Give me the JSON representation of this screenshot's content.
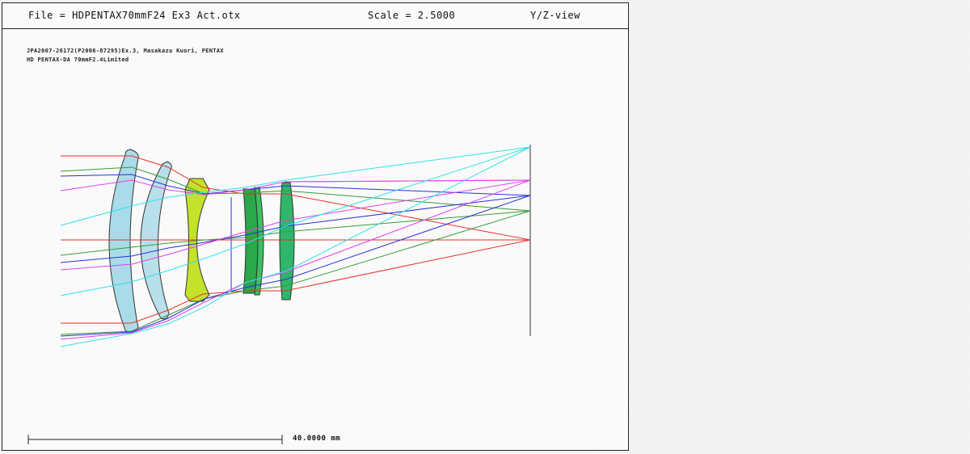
{
  "header": {
    "file": "File = HDPENTAX70mmF24 Ex3 Act.otx",
    "scale": "Scale = 2.5000",
    "view": "Y/Z-view"
  },
  "description": {
    "line1": "JPA2007-26172(P2006-87295)Ex.3, Masakazu Kuori, PENTAX",
    "line2": "HD PENTAX-DA 70mmF2.4Limited"
  },
  "scale_bar": {
    "label": "40.0000 mm"
  },
  "colors": {
    "lens1": "#a9dbe8",
    "lens2": "#b8e0ea",
    "lens3": "#c4e22a",
    "lens4": "#2aa84a",
    "lens5": "#2fb66a",
    "ray_red": "#e8302a",
    "ray_green": "#3a9a3a",
    "ray_blue": "#2a32d8",
    "ray_magenta": "#e040e8",
    "ray_cyan": "#30e0e8"
  }
}
